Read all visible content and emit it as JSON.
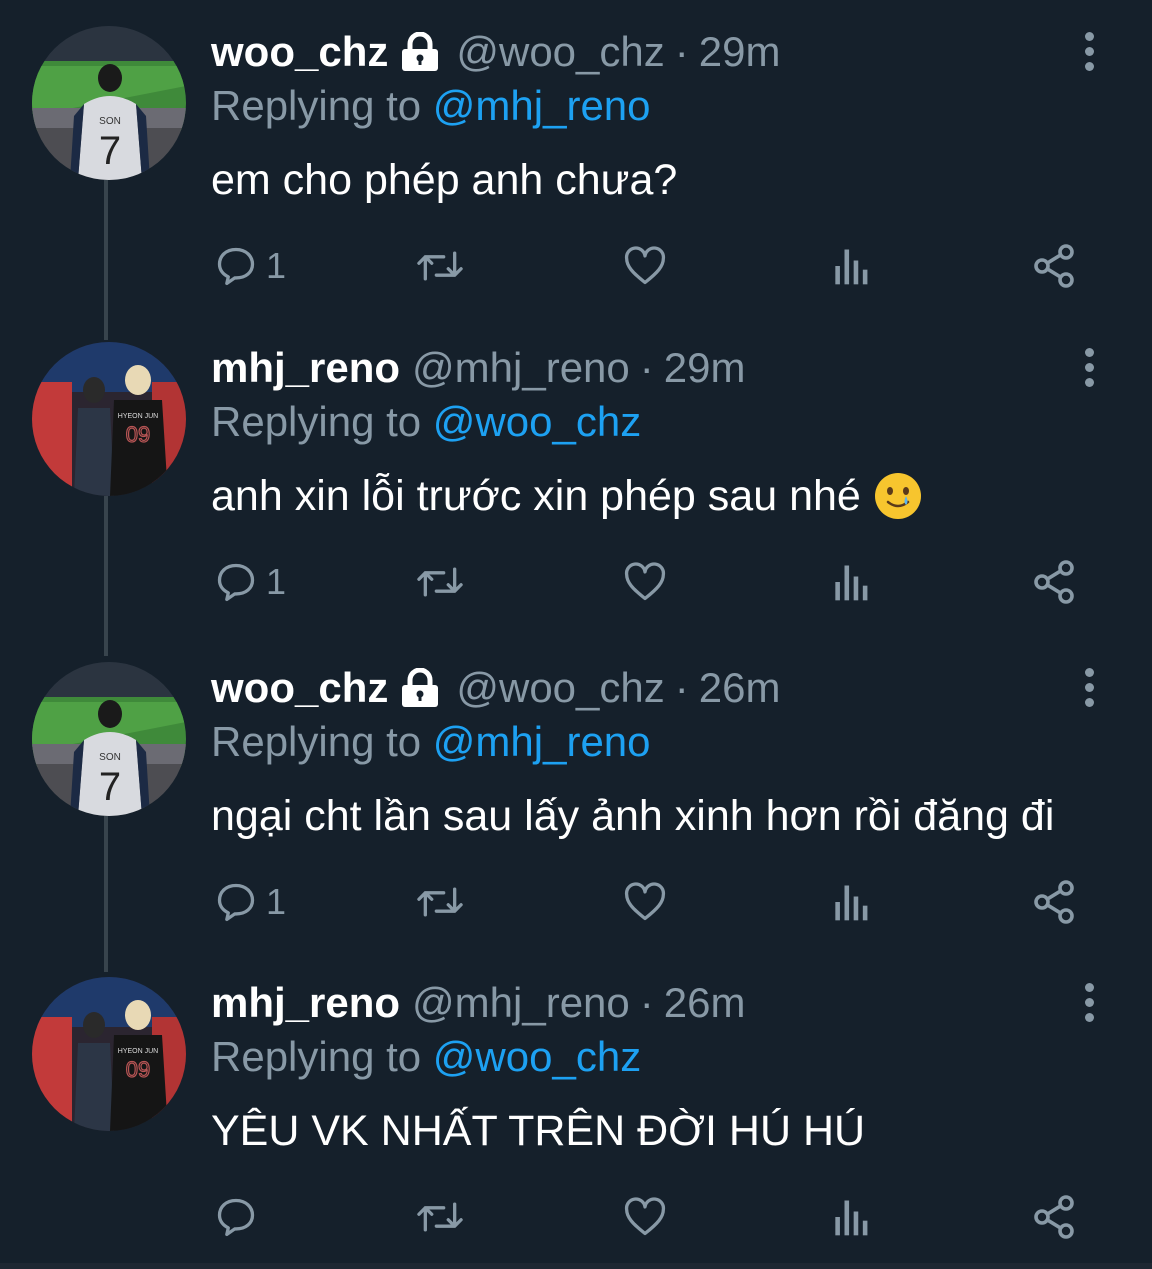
{
  "colors": {
    "background": "#15202b",
    "text_primary": "#ffffff",
    "text_secondary": "#8899a6",
    "mention": "#1da1f2",
    "thread_line": "#38444d"
  },
  "tweets": [
    {
      "display_name": "woo_chz",
      "protected": true,
      "handle": "@woo_chz",
      "separator": "·",
      "time": "29m",
      "replying_prefix": "Replying to",
      "replying_to": "@mhj_reno",
      "text": "em cho phép anh chưa?",
      "emoji": "",
      "reply_count": "1",
      "avatar": "stadium-avatar"
    },
    {
      "display_name": "mhj_reno",
      "protected": false,
      "handle": "@mhj_reno",
      "separator": "·",
      "time": "29m",
      "replying_prefix": "Replying to",
      "replying_to": "@woo_chz",
      "text": "anh xin lỗi trước xin phép sau nhé",
      "emoji": "smiling-tear-emoji",
      "reply_count": "1",
      "avatar": "jersey-avatar"
    },
    {
      "display_name": "woo_chz",
      "protected": true,
      "handle": "@woo_chz",
      "separator": "·",
      "time": "26m",
      "replying_prefix": "Replying to",
      "replying_to": "@mhj_reno",
      "text": "ngại cht lần sau lấy ảnh xinh hơn rồi đăng đi",
      "emoji": "",
      "reply_count": "1",
      "avatar": "stadium-avatar"
    },
    {
      "display_name": "mhj_reno",
      "protected": false,
      "handle": "@mhj_reno",
      "separator": "·",
      "time": "26m",
      "replying_prefix": "Replying to",
      "replying_to": "@woo_chz",
      "text": "YÊU VK NHẤT TRÊN ĐỜI HÚ HÚ",
      "emoji": "",
      "reply_count": "",
      "avatar": "jersey-avatar"
    }
  ],
  "icons": {
    "reply": "reply-icon",
    "retweet": "retweet-icon",
    "like": "heart-icon",
    "analytics": "analytics-icon",
    "share": "share-icon",
    "more": "more-vertical-icon",
    "lock": "lock-icon"
  },
  "avatar_text": {
    "stadium_jersey_name": "SON",
    "stadium_jersey_number": "7",
    "jersey_name": "HYEON JUN",
    "jersey_number": "09"
  }
}
